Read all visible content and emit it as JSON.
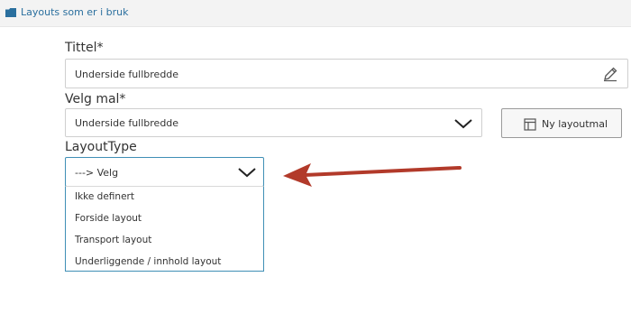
{
  "topbar": {
    "label": "Layouts som er i bruk"
  },
  "form": {
    "title_label": "Tittel*",
    "title_value": "Underside fullbredde",
    "template_label": "Velg mal*",
    "template_value": "Underside fullbredde",
    "new_template_button": "Ny layoutmal",
    "layouttype_label": "LayoutType",
    "layouttype_value": "---> Velg",
    "layouttype_options": [
      "Ikke definert",
      "Forside layout",
      "Transport layout",
      "Underliggende / innhold layout"
    ]
  },
  "colors": {
    "link": "#2a6f9e",
    "focus_border": "#3f8fb5",
    "annotation_arrow": "#b23a2a"
  }
}
